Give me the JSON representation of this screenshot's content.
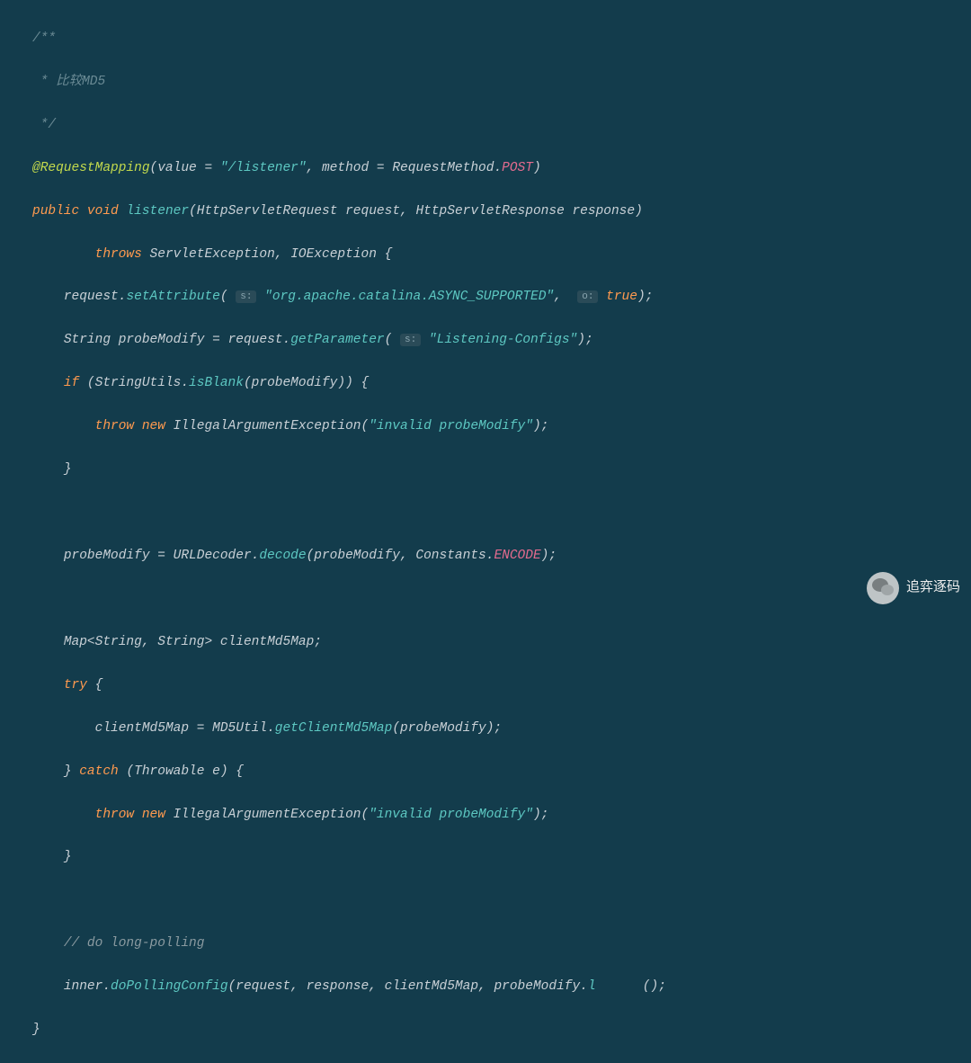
{
  "code": {
    "comment_block": {
      "open": "/**",
      "line1": " * 比较MD5",
      "close": " */"
    },
    "annotation": {
      "name": "@RequestMapping",
      "value_key": "value",
      "value_str": "\"/listener\"",
      "method_key": "method",
      "method_class": "RequestMethod",
      "method_val": "POST"
    },
    "signature": {
      "public": "public",
      "void": "void",
      "name": "listener",
      "param1_type": "HttpServletRequest",
      "param1_name": "request",
      "param2_type": "HttpServletResponse",
      "param2_name": "response"
    },
    "throws": {
      "kw": "throws",
      "ex1": "ServletException",
      "ex2": "IOException"
    },
    "l_setattr": {
      "obj": "request",
      "method": "setAttribute",
      "hint1": "s:",
      "arg1": "\"org.apache.catalina.ASYNC_SUPPORTED\"",
      "hint2": "o:",
      "arg2": "true"
    },
    "l_getparam": {
      "type": "String",
      "var": "probeModify",
      "obj": "request",
      "method": "getParameter",
      "hint": "s:",
      "arg": "\"Listening-Configs\""
    },
    "l_if": {
      "kw": "if",
      "cls": "StringUtils",
      "method": "isBlank",
      "arg": "probeModify"
    },
    "l_throw1": {
      "throw": "throw",
      "new": "new",
      "cls": "IllegalArgumentException",
      "msg": "\"invalid probeModify\""
    },
    "l_decode": {
      "var": "probeModify",
      "cls": "URLDecoder",
      "method": "decode",
      "arg1": "probeModify",
      "const_cls": "Constants",
      "const_val": "ENCODE"
    },
    "l_mapdecl": {
      "type1": "Map",
      "type2": "String",
      "type3": "String",
      "var": "clientMd5Map"
    },
    "l_try": {
      "kw": "try"
    },
    "l_assign": {
      "var": "clientMd5Map",
      "cls": "MD5Util",
      "method": "getClientMd5Map",
      "arg": "probeModify"
    },
    "l_catch": {
      "kw": "catch",
      "type": "Throwable",
      "name": "e"
    },
    "l_throw2": {
      "throw": "throw",
      "new": "new",
      "cls": "IllegalArgumentException",
      "msg": "\"invalid probeModify\""
    },
    "l_comment": "// do long-polling",
    "l_poll": {
      "obj": "inner",
      "method": "doPollingConfig",
      "arg1": "request",
      "arg2": "response",
      "arg3": "clientMd5Map",
      "arg4": "probeModify",
      "tail_method": "l",
      "tail_suffix": "()"
    }
  },
  "watermark": "追弈逐码"
}
